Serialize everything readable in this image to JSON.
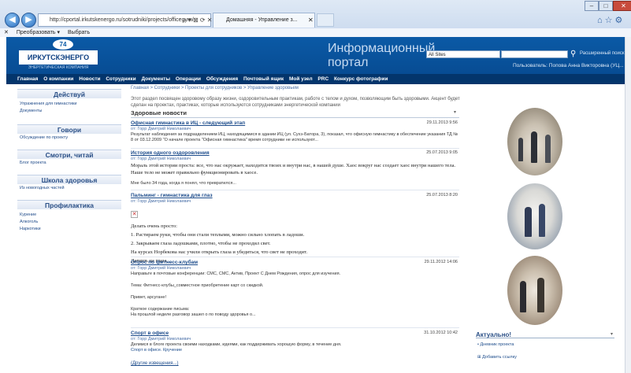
{
  "browser": {
    "address": "http://cportal.irkutskenergo.ru/sotrudniki/projects/officegym/",
    "address_icons": "⌕ ▾ ⊠ ⟳ ✕",
    "tab_title": "Домашняя - Управление з...",
    "cmd_items": [
      "Преобразовать ▾",
      "Выбрать"
    ]
  },
  "header": {
    "logo_text": "ИРКУТСКЭНЕРГО",
    "logo_emblem": "74",
    "logo_subtitle": "ЭНЕРГЕТИЧЕСКАЯ КОМПАНИЯ",
    "portal_title": "Информационный портал",
    "search_scope": "All Sites",
    "advanced_search": "Расширенный поиск",
    "user_line": "Пользователь: Попова Анна Викторовна (УЦ... ▾"
  },
  "topnav": [
    "Главная",
    "О компании",
    "Новости",
    "Сотрудники",
    "Документы",
    "Операции",
    "Обсуждения",
    "Почтовый ящик",
    "Мой узел",
    "PRC",
    "Конкурс фотографии"
  ],
  "sidebar": {
    "sections": [
      {
        "title": "Действуй",
        "links": [
          "Упражнения для гимнастики",
          "Документы"
        ]
      },
      {
        "title": "Говори",
        "links": [
          "Обсуждение по проекту"
        ]
      },
      {
        "title": "Смотри, читай",
        "links": [
          "Блог проекта"
        ]
      },
      {
        "title": "Школа здоровья",
        "links": [
          "Из новогодных частей"
        ]
      },
      {
        "title": "Профилактика",
        "links": [
          "Курение",
          "Алкоголь",
          "Наркотики"
        ]
      }
    ]
  },
  "breadcrumb": "Главная > Сотрудники > Проекты для сотрудников > Управление здоровьем",
  "intro": "Этот раздел посвящен здоровому образу жизни, оздоровительным практикам, работе с телом и духом, позволяющим быть здоровыми. Акцент будет сделан на проектах, практиках, которые используются сотрудниками энергетической компании",
  "news_header": "Здоровые новости",
  "news": [
    {
      "title": "Офисная гимнастика в ИЦ - следующий этап",
      "date": "29.11.2013 9:56",
      "author": "от: Горр Дмитрий Николаевич",
      "body": "Результат наблюдения за подразделением ИЦ, находящимися в здании ИЦ (ул. Сухэ-Батора, 3), показал, что офисную гимнастику в обеспечение указания ТД № 8 от 03.12.2009 \"О начале проекта \"Офисная гимнастика\" время сотрудники не используют..."
    },
    {
      "title": "История одного оздоровления",
      "date": "25.07.2013 9:05",
      "author": "от: Горр Дмитрий Николаевич",
      "body": "Мораль этой истории проста: все, что нас окружает, находится твоих и внутри нас, в нашей душе. Хаос вокруг нас создает хаос внутри нашего тела. Наше тело не может правильно функционировать в хаосе.",
      "body2": "Мне было 34 года, когда я понял, что превратился..."
    },
    {
      "title": "Пальминг - гимнастика для глаз",
      "date": "25.07.2013 8:20",
      "author": "от: Горр Дмитрий Николаевич",
      "lines": [
        "Делать очень просто:",
        "1. Растираем руки, чтобы они стали теплыми, можно сильно хлопать в ладоши.",
        "2. Закрываем глаза ладошками, плотно, чтобы не проходил свет.",
        "На курсах Норбекова нас учили открыть глаза и убедиться, что свет не проходит.",
        "Давишь на глаза..."
      ]
    },
    {
      "title": "Опрос по фитнесс-клубам",
      "date": "29.11.2012 14:06",
      "author": "от: Горр Дмитрий Николаевич",
      "lines": [
        "Направьте в почтовые конференции: СМС, СМС, Актив, Проект С Днем Рождения, опрос для изучения.",
        "Тема: Фитнесс-клубы_совместное приобретение карт со скидкой.",
        "Привет, арсугане!",
        "Краткое содержание письма:",
        "На прошлой неделе разговор зашел о по поводу здоровья о..."
      ]
    },
    {
      "title": "Спорт в офисе",
      "date": "31.10.2012 10:42",
      "author": "от: Горр Дмитрий Николаевич",
      "lines": [
        "Делимся в блоге проекта своими находками, идеями, как поддерживать хорошую форму, в течение дня.",
        "Спорт в офисе. Кручение"
      ]
    }
  ],
  "more_news": "(Другие извещения...)",
  "aktual": {
    "title": "Актуально!",
    "link": "• Дневник проекта",
    "add": "⊞ Добавить ссылку"
  }
}
